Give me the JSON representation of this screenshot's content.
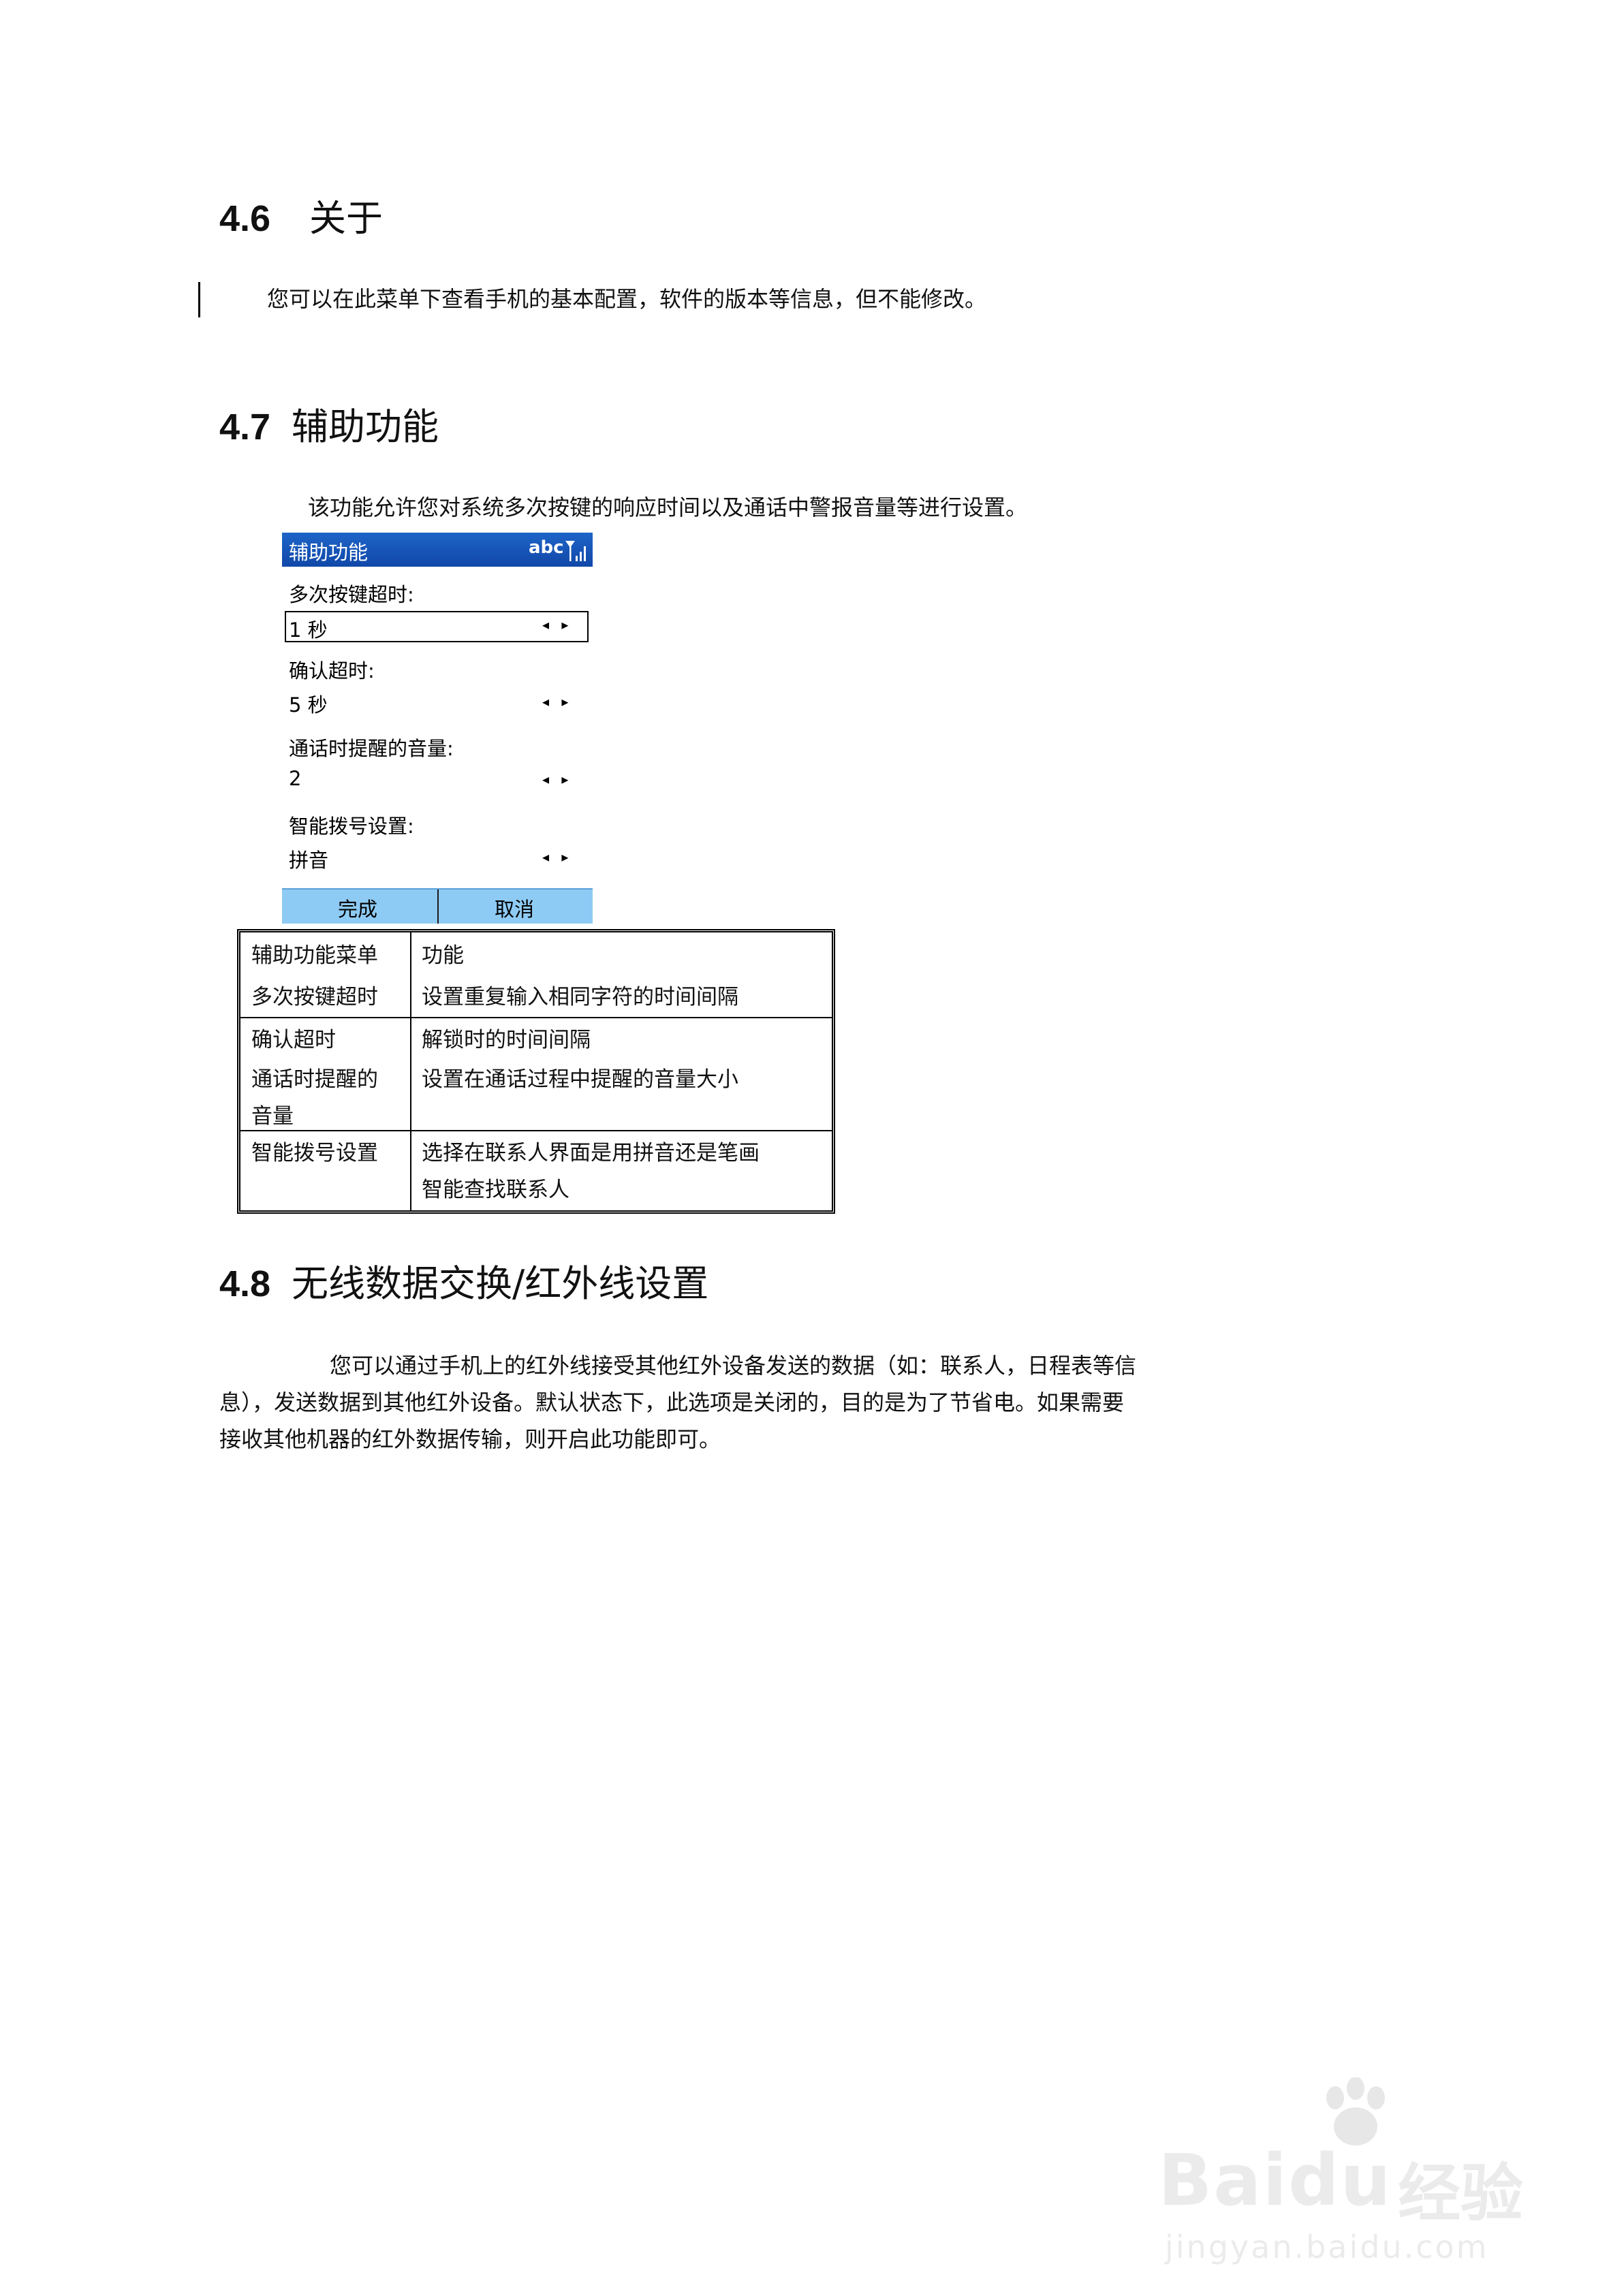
{
  "sections": [
    {
      "num": "4.6",
      "title": "关于"
    },
    {
      "num": "4.7",
      "title": "辅助功能"
    },
    {
      "num": "4.8",
      "title": "无线数据交换/红外线设置"
    }
  ],
  "about_text": "您可以在此菜单下查看手机的基本配置，软件的版本等信息，但不能修改。",
  "assist_intro": "该功能允许您对系统多次按键的响应时间以及通话中警报音量等进行设置。",
  "phone": {
    "title": "辅助功能",
    "indicator": "abc",
    "fields": [
      {
        "label": "多次按键超时:",
        "value": "1 秒"
      },
      {
        "label": "确认超时:",
        "value": "5 秒"
      },
      {
        "label": "通话时提醒的音量:",
        "value": "2"
      },
      {
        "label": "智能拨号设置:",
        "value": "拼音"
      }
    ],
    "arrows": "◂ ▸",
    "softkeys": {
      "left": "完成",
      "right": "取消"
    }
  },
  "table": {
    "col1": [
      "辅助功能菜单",
      "多次按键超时",
      "确认超时",
      "通话时提醒的",
      "音量",
      "智能拨号设置"
    ],
    "col2": [
      "功能",
      "设置重复输入相同字符的时间间隔",
      "解锁时的时间间隔",
      "设置在通话过程中提醒的音量大小",
      "选择在联系人界面是用拼音还是笔画",
      "智能查找联系人"
    ]
  },
  "ir_lines": [
    "您可以通过手机上的红外线接受其他红外设备发送的数据（如：联系人，日程表等信",
    "息），发送数据到其他红外设备。默认状态下，此选项是关闭的，目的是为了节省电。如果需要",
    "接收其他机器的红外数据传输，则开启此功能即可。"
  ],
  "watermark": {
    "brand": "Baidu",
    "cn": "经验",
    "url": "jingyan.baidu.com"
  }
}
